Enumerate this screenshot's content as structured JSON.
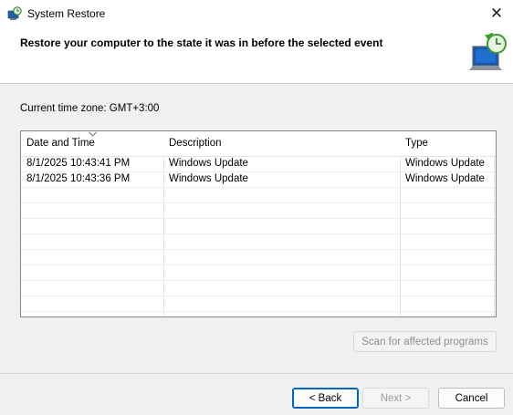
{
  "window": {
    "title": "System Restore",
    "close_glyph": "✕"
  },
  "header": {
    "instruction": "Restore your computer to the state it was in before the selected event"
  },
  "timezone": {
    "label": "Current time zone: GMT+3:00"
  },
  "table": {
    "columns": [
      "Date and Time",
      "Description",
      "Type"
    ],
    "sorted_column": "Date and Time",
    "rows": [
      {
        "date": "8/1/2025 10:43:41 PM",
        "description": "Windows Update",
        "type": "Windows Update"
      },
      {
        "date": "8/1/2025 10:43:36 PM",
        "description": "Windows Update",
        "type": "Windows Update"
      }
    ]
  },
  "buttons": {
    "scan": "Scan for affected programs",
    "back": "< Back",
    "next": "Next >",
    "cancel": "Cancel"
  },
  "icons": {
    "app": "system-restore-icon",
    "header": "restore-monitor-clock-icon",
    "sort": "sort-descending-icon"
  }
}
